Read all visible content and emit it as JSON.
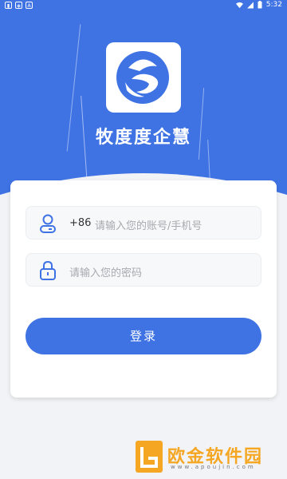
{
  "status_bar": {
    "time": "5:32",
    "left_icons": [
      "sim-icon",
      "notification-icon",
      "a-icon"
    ]
  },
  "app": {
    "title": "牧度度企慧"
  },
  "login_form": {
    "phone_prefix": "+86",
    "account_placeholder": "请输入您的账号/手机号",
    "password_placeholder": "请输入您的密码",
    "login_label": "登录"
  },
  "watermark": {
    "brand": "欧金软件园",
    "url": "www.apoujin.com"
  },
  "colors": {
    "primary": "#3f73e4",
    "background": "#f2f3f6",
    "card": "#ffffff",
    "placeholder": "#a6a9ae",
    "watermark": "#f5a623"
  }
}
